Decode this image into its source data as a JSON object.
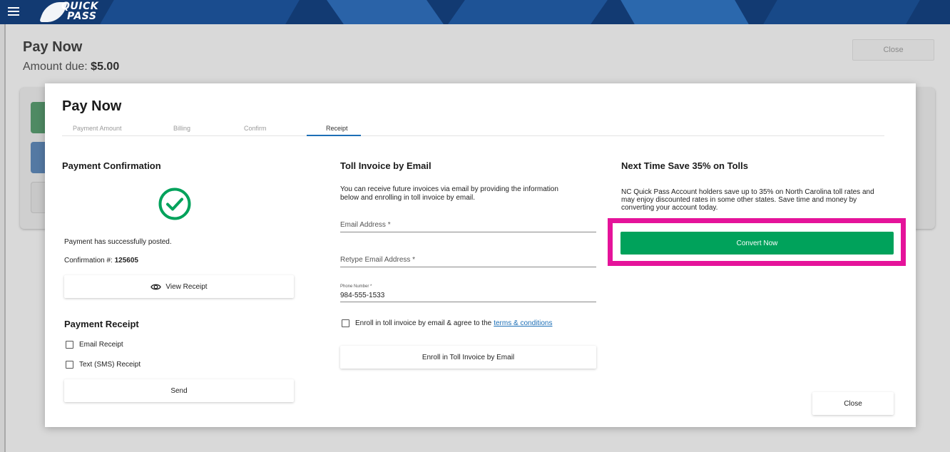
{
  "header": {
    "logo_line1": "QUICK",
    "logo_line2": "PASS"
  },
  "background_page": {
    "title": "Pay Now",
    "amount_label": "Amount due: ",
    "amount_value": "$5.00",
    "close_label": "Close"
  },
  "modal": {
    "title": "Pay Now",
    "tabs": [
      {
        "label": "Payment Amount"
      },
      {
        "label": "Billing"
      },
      {
        "label": "Confirm"
      },
      {
        "label": "Receipt"
      }
    ],
    "payment_confirmation": {
      "heading": "Payment Confirmation",
      "posted_text": "Payment has successfully posted.",
      "confirmation_label": "Confirmation #:",
      "confirmation_number": "125605",
      "view_receipt_label": "View Receipt"
    },
    "payment_receipt": {
      "heading": "Payment Receipt",
      "email_receipt_label": "Email Receipt",
      "sms_receipt_label": "Text (SMS) Receipt",
      "send_label": "Send"
    },
    "toll_invoice": {
      "heading": "Toll Invoice by Email",
      "description_line1": "You can receive future invoices via email by providing the information",
      "description_line2": "below and enrolling in toll invoice by email.",
      "email_placeholder": "Email Address *",
      "retype_email_placeholder": "Retype Email Address *",
      "phone_label": "Phone Number *",
      "phone_value": "984-555-1533",
      "enroll_text": "Enroll in toll invoice by email & agree to the ",
      "terms_link": "terms & conditions",
      "enroll_button_label": "Enroll in Toll Invoice by Email"
    },
    "promo": {
      "heading": "Next Time Save 35% on Tolls",
      "text_line1": "NC Quick Pass Account holders save up to 35% on North Carolina toll rates and",
      "text_line2": "may enjoy discounted rates in some other states. Save time and money by",
      "text_line3": "converting your account today.",
      "convert_label": "Convert Now"
    },
    "close_label": "Close"
  },
  "colors": {
    "header_blue": "#123a72",
    "success_green": "#00a25b",
    "highlight_magenta": "#e5139a",
    "link_blue": "#1d6fb6"
  },
  "icons": [
    "menu-icon",
    "check-circle-icon",
    "eye-icon"
  ]
}
